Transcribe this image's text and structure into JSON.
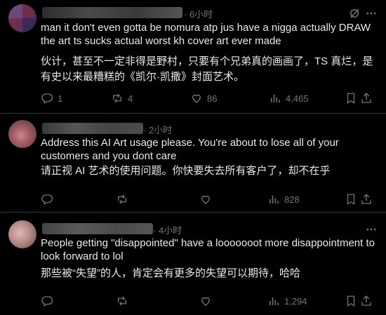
{
  "posts": [
    {
      "time": "· 6小时",
      "text": "man it don't even gotta be nomura atp jus have a nigga actually DRAW the art ts sucks actual worst kh cover art ever made",
      "translation": "伙计，甚至不一定非得是野村，只要有个兄弟真的画画了，TS 真烂，是有史以来最糟糕的《凯尔·凯撒》封面艺术。",
      "replies": "1",
      "reposts": "4",
      "likes": "86",
      "views": "4,465"
    },
    {
      "time": "· 2小时",
      "text": "Address this AI Art usage please. You're about to lose all of your customers and you dont care",
      "translation": "请正视 AI 艺术的使用问题。你快要失去所有客户了，却不在乎",
      "replies": "",
      "reposts": "",
      "likes": "",
      "views": "828"
    },
    {
      "time": "· 4小时",
      "text": "People getting \"disappointed\" have a looooooot more disappointment to look forward to lol",
      "translation": "那些被“失望”的人，肯定会有更多的失望可以期待，哈哈",
      "replies": "",
      "reposts": "",
      "likes": "",
      "views": "1,294"
    }
  ],
  "icons": {
    "reply": "reply-icon",
    "repost": "repost-icon",
    "like": "heart-icon",
    "views": "views-icon",
    "bookmark": "bookmark-icon",
    "share": "share-icon",
    "grok": "grok-icon",
    "more": "more-icon"
  },
  "colors": {
    "background": "#000000",
    "text": "#e7e9ea",
    "muted": "#71767b",
    "divider": "#2f3336"
  }
}
